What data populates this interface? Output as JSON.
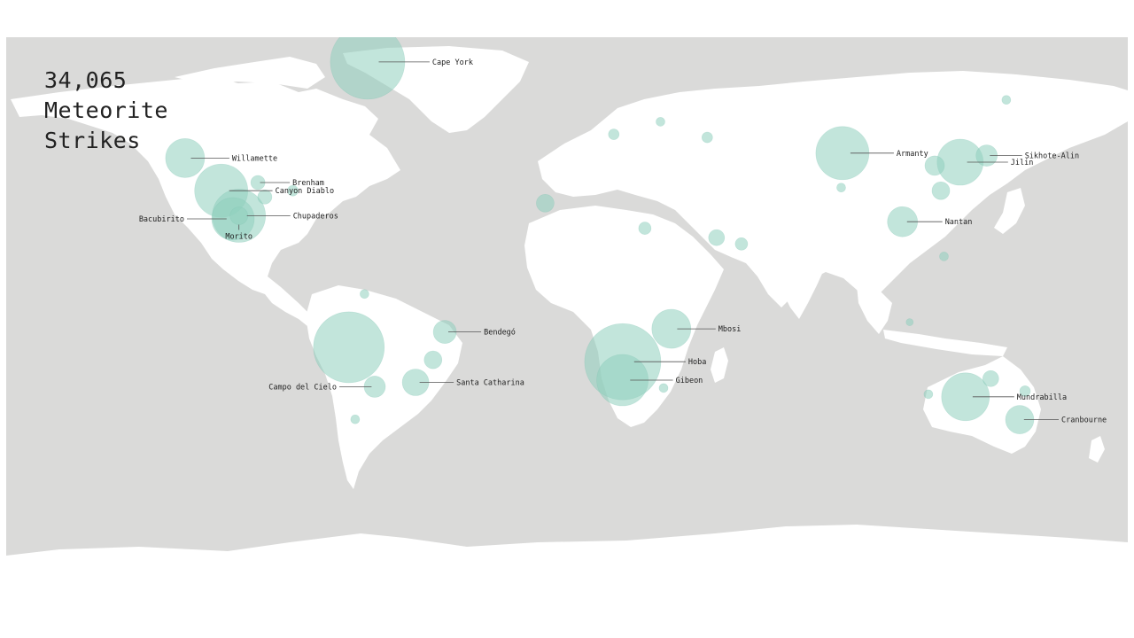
{
  "title": {
    "count": "34,065",
    "line2": "Meteorite",
    "line3": "Strikes"
  },
  "colors": {
    "ocean": "#dadad9",
    "land": "#ffffff",
    "strike": "#8fcfbd"
  },
  "projection": "equirectangular",
  "strikes": [
    {
      "name": "Cape York",
      "lon": -64.0,
      "lat": 76.1,
      "r": 42,
      "label": true,
      "label_side": "right"
    },
    {
      "name": "Willamette",
      "lon": -122.6,
      "lat": 45.4,
      "r": 22,
      "label": true,
      "label_side": "right"
    },
    {
      "name": "Brenham",
      "lon": -99.2,
      "lat": 37.6,
      "r": 8,
      "label": true,
      "label_side": "right"
    },
    {
      "name": "Canyon Diablo",
      "lon": -111.0,
      "lat": 35.0,
      "r": 30,
      "label": true,
      "label_side": "right"
    },
    {
      "name": "Chupaderos",
      "lon": -105.3,
      "lat": 27.0,
      "r": 30,
      "label": true,
      "label_side": "right"
    },
    {
      "name": "Bacubirito",
      "lon": -107.2,
      "lat": 26.0,
      "r": 24,
      "label": true,
      "label_side": "left"
    },
    {
      "name": "Morito",
      "lon": -105.3,
      "lat": 27.0,
      "r": 10,
      "label": true,
      "label_side": "below"
    },
    {
      "name": "Bendegó",
      "lon": -39.2,
      "lat": -10.1,
      "r": 13,
      "label": true,
      "label_side": "right"
    },
    {
      "name": "Campo del Cielo",
      "lon": -61.7,
      "lat": -27.6,
      "r": 12,
      "label": true,
      "label_side": "left"
    },
    {
      "name": "Santa Catharina",
      "lon": -48.6,
      "lat": -26.2,
      "r": 15,
      "label": true,
      "label_side": "right"
    },
    {
      "name": "Hoba",
      "lon": 17.9,
      "lat": -19.6,
      "r": 43,
      "label": true,
      "label_side": "right"
    },
    {
      "name": "Gibeon",
      "lon": 17.8,
      "lat": -25.5,
      "r": 29,
      "label": true,
      "label_side": "right"
    },
    {
      "name": "Mbosi",
      "lon": 33.5,
      "lat": -9.1,
      "r": 22,
      "label": true,
      "label_side": "right"
    },
    {
      "name": "Armanty",
      "lon": 88.4,
      "lat": 47.0,
      "r": 30,
      "label": true,
      "label_side": "right"
    },
    {
      "name": "Jilin",
      "lon": 126.2,
      "lat": 44.1,
      "r": 26,
      "label": true,
      "label_side": "right"
    },
    {
      "name": "Sikhote-Alin",
      "lon": 134.7,
      "lat": 46.2,
      "r": 12,
      "label": true,
      "label_side": "right"
    },
    {
      "name": "Nantan",
      "lon": 107.7,
      "lat": 25.1,
      "r": 17,
      "label": true,
      "label_side": "right"
    },
    {
      "name": "Mundrabilla",
      "lon": 127.9,
      "lat": -30.8,
      "r": 27,
      "label": true,
      "label_side": "right"
    },
    {
      "name": "Cranbourne",
      "lon": 145.3,
      "lat": -38.1,
      "r": 16,
      "label": true,
      "label_side": "right"
    },
    {
      "name": "",
      "lon": -70.0,
      "lat": -15.0,
      "r": 40,
      "label": false
    },
    {
      "name": "",
      "lon": -97.0,
      "lat": 33.0,
      "r": 8,
      "label": false
    },
    {
      "name": "",
      "lon": -88.0,
      "lat": 35.0,
      "r": 6,
      "label": false
    },
    {
      "name": "",
      "lon": -43.0,
      "lat": -19.0,
      "r": 10,
      "label": false
    },
    {
      "name": "",
      "lon": -7.0,
      "lat": 31.0,
      "r": 10,
      "label": false
    },
    {
      "name": "",
      "lon": 48.0,
      "lat": 20.0,
      "r": 9,
      "label": false
    },
    {
      "name": "",
      "lon": 56.0,
      "lat": 18.0,
      "r": 7,
      "label": false
    },
    {
      "name": "",
      "lon": 25.0,
      "lat": 23.0,
      "r": 7,
      "label": false
    },
    {
      "name": "",
      "lon": 45.0,
      "lat": 52.0,
      "r": 6,
      "label": false
    },
    {
      "name": "",
      "lon": 118.0,
      "lat": 43.0,
      "r": 11,
      "label": false
    },
    {
      "name": "",
      "lon": 120.0,
      "lat": 35.0,
      "r": 10,
      "label": false
    },
    {
      "name": "",
      "lon": 88.0,
      "lat": 36.0,
      "r": 5,
      "label": false
    },
    {
      "name": "",
      "lon": 141.0,
      "lat": 64.0,
      "r": 5,
      "label": false
    },
    {
      "name": "",
      "lon": 136.0,
      "lat": -25.0,
      "r": 9,
      "label": false
    },
    {
      "name": "",
      "lon": 147.0,
      "lat": -29.0,
      "r": 6,
      "label": false
    },
    {
      "name": "",
      "lon": 116.0,
      "lat": -30.0,
      "r": 5,
      "label": false
    },
    {
      "name": "",
      "lon": 15.0,
      "lat": 53.0,
      "r": 6,
      "label": false
    },
    {
      "name": "",
      "lon": 30.0,
      "lat": 57.0,
      "r": 5,
      "label": false
    },
    {
      "name": "",
      "lon": 31.0,
      "lat": -28.0,
      "r": 5,
      "label": false
    },
    {
      "name": "",
      "lon": 121.0,
      "lat": 14.0,
      "r": 5,
      "label": false
    },
    {
      "name": "",
      "lon": -68.0,
      "lat": -38.0,
      "r": 5,
      "label": false
    },
    {
      "name": "",
      "lon": -65.0,
      "lat": 2.0,
      "r": 5,
      "label": false
    },
    {
      "name": "",
      "lon": 110.0,
      "lat": -7.0,
      "r": 4,
      "label": false
    }
  ]
}
